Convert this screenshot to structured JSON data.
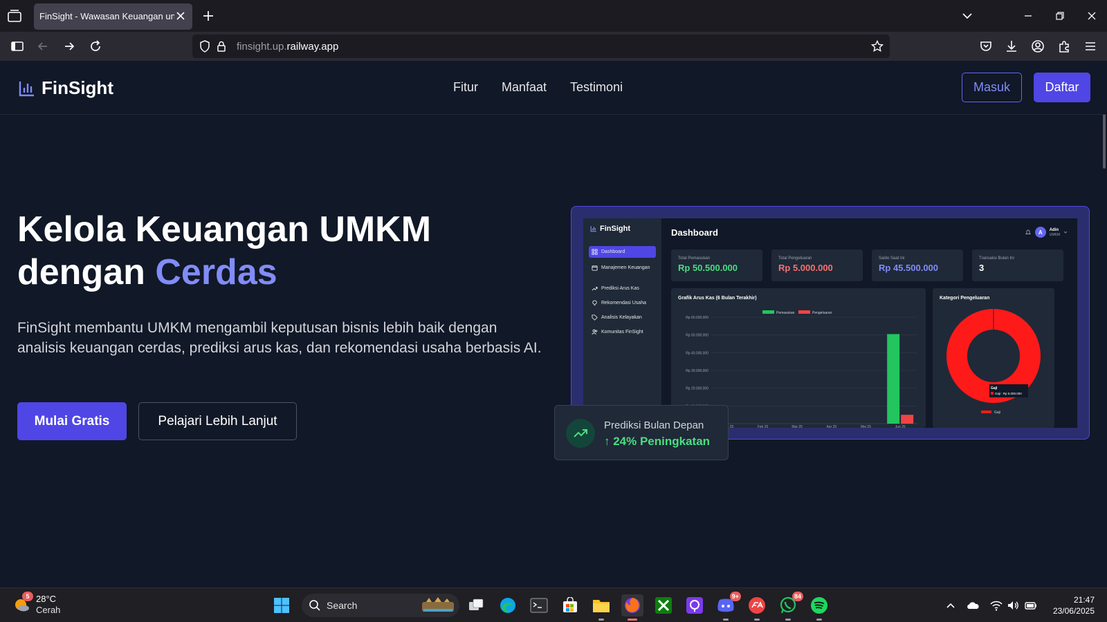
{
  "browser": {
    "tab_title": "FinSight - Wawasan Keuangan untuk UMKM",
    "url_host": "finsight.up.",
    "url_domain": "railway.app"
  },
  "site": {
    "brand": "FinSight",
    "menu": [
      "Fitur",
      "Manfaat",
      "Testimoni"
    ],
    "login": "Masuk",
    "register": "Daftar"
  },
  "hero": {
    "title_line1": "Kelola Keuangan UMKM",
    "title_line2_pre": "dengan ",
    "title_accent": "Cerdas",
    "description": "FinSight membantu UMKM mengambil keputusan bisnis lebih baik dengan analisis keuangan cerdas, prediksi arus kas, dan rekomendasi usaha berbasis AI.",
    "cta_primary": "Mulai Gratis",
    "cta_secondary": "Pelajari Lebih Lanjut",
    "accent_color": "#818cf8"
  },
  "mockup": {
    "brand": "FinSight",
    "title": "Dashboard",
    "user_initial": "A",
    "user_name": "Adin",
    "user_role": "UMKM",
    "sidebar": [
      {
        "label": "Dashboard",
        "icon": "grid-icon",
        "active": true
      },
      {
        "label": "Manajemen Keuangan",
        "icon": "wallet-icon",
        "active": false
      },
      {
        "label": "Prediksi Arus Kas",
        "icon": "trend-icon",
        "active": false
      },
      {
        "label": "Rekomendasi Usaha",
        "icon": "bulb-icon",
        "active": false
      },
      {
        "label": "Analisis Kelayakan",
        "icon": "tag-icon",
        "active": false
      },
      {
        "label": "Komunitas FinSight",
        "icon": "users-icon",
        "active": false
      }
    ],
    "stats": [
      {
        "label": "Total Pemasukan",
        "value": "Rp 50.500.000",
        "color": "#4ade80"
      },
      {
        "label": "Total Pengeluaran",
        "value": "Rp 5.000.000",
        "color": "#f87171"
      },
      {
        "label": "Saldo Saat Ini",
        "value": "Rp 45.500.000",
        "color": "#818cf8"
      },
      {
        "label": "Transaksi Bulan Ini",
        "value": "3",
        "color": "#ffffff"
      }
    ],
    "cashflow_title": "Grafik Arus Kas (6 Bulan Terakhir)",
    "category_title": "Kategori Pengeluaran",
    "tooltip_title": "Gaji",
    "tooltip_value": "Gaji : Rp 5.000.000"
  },
  "chart_data": [
    {
      "type": "bar",
      "title": "Grafik Arus Kas (6 Bulan Terakhir)",
      "categories": [
        "Jan 25",
        "Feb 25",
        "Mar 25",
        "Apr 25",
        "Mei 25",
        "Jun 25"
      ],
      "series": [
        {
          "name": "Pemasukan",
          "color": "#22c55e",
          "values": [
            0,
            0,
            0,
            0,
            0,
            50500000
          ]
        },
        {
          "name": "Pengeluaran",
          "color": "#ef4444",
          "values": [
            0,
            0,
            0,
            0,
            0,
            5000000
          ]
        }
      ],
      "ytick_labels": [
        "Rp 60.000.000",
        "Rp 50.000.000",
        "Rp 40.000.000",
        "Rp 30.000.000",
        "Rp 20.000.000",
        "Rp 10.000.000"
      ],
      "ytick_values": [
        60000000,
        50000000,
        40000000,
        30000000,
        20000000,
        10000000
      ],
      "ylim": [
        0,
        60000000
      ],
      "legend": "top-center",
      "grid": true
    },
    {
      "type": "pie",
      "title": "Kategori Pengeluaran",
      "labels": [
        "Gaji"
      ],
      "values": [
        5000000
      ],
      "colors": [
        "#ff1a1a"
      ],
      "donut": true,
      "legend": "bottom"
    }
  ],
  "prediction": {
    "label": "Prediksi Bulan Depan",
    "value": "↑ 24% Peningkatan"
  },
  "taskbar": {
    "weather_temp": "28°C",
    "weather_cond": "Cerah",
    "weather_badge": "5",
    "search_label": "Search",
    "discord_badge": "9+",
    "whatsapp_badge": "84",
    "time": "21:47",
    "date": "23/06/2025"
  }
}
